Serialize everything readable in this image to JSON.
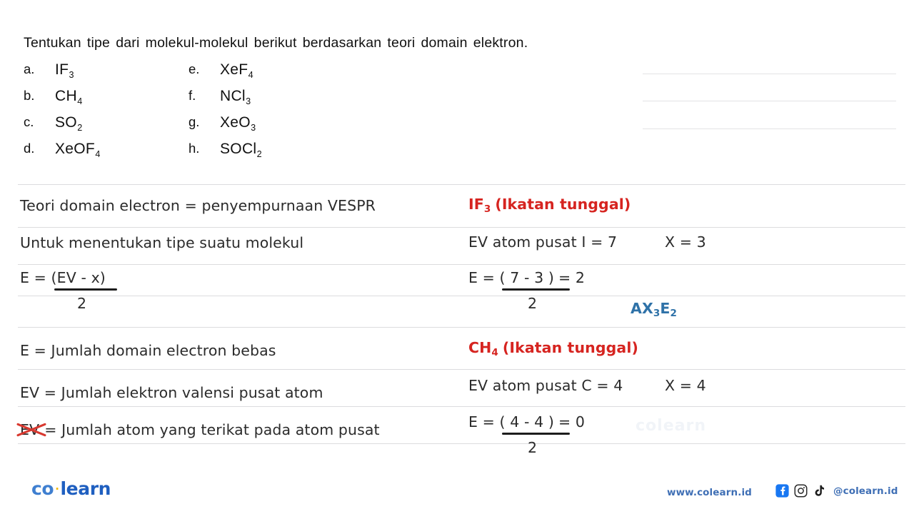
{
  "question": {
    "stem": "Tentukan tipe dari molekul-molekul berikut berdasarkan teori domain elektron.",
    "left_column": [
      {
        "marker": "a.",
        "formula": "IF",
        "sub": "3"
      },
      {
        "marker": "b.",
        "formula": "CH",
        "sub": "4"
      },
      {
        "marker": "c.",
        "formula": "SO",
        "sub": "2"
      },
      {
        "marker": "d.",
        "formula": "XeOF",
        "sub": "4"
      }
    ],
    "right_column": [
      {
        "marker": "e.",
        "formula": "XeF",
        "sub": "4"
      },
      {
        "marker": "f.",
        "formula": "NCl",
        "sub": "3"
      },
      {
        "marker": "g.",
        "formula": "XeO",
        "sub": "3"
      },
      {
        "marker": "h.",
        "formula": "SOCl",
        "sub": "2"
      }
    ]
  },
  "notes_left": {
    "line1": "Teori domain electron = penyempurnaan VESPR",
    "line2": "Untuk menentukan tipe suatu molekul",
    "formula_numerator": "E = (EV - x)",
    "formula_denominator": "2",
    "def_E": "E = Jumlah domain electron bebas",
    "def_EV": "EV = Jumlah elektron valensi pusat atom",
    "def_X_token": "EV",
    "def_X_rest": "= Jumlah atom yang terikat pada atom pusat"
  },
  "notes_right": {
    "block1": {
      "heading": "IF",
      "heading_sub": "3",
      "heading_tail": "(Ikatan tunggal)",
      "ev_label": "EV atom pusat I = 7",
      "x_label": "X = 3",
      "calc_numerator": "E = ( 7  - 3 )",
      "calc_result": "= 2",
      "calc_denominator": "2",
      "answer": "AX",
      "answer_sub1": "3",
      "answer_mid": "E",
      "answer_sub2": "2"
    },
    "block2": {
      "heading": "CH",
      "heading_sub": "4",
      "heading_tail": "(Ikatan tunggal)",
      "ev_label": "EV atom pusat C = 4",
      "x_label": "X = 4",
      "calc_numerator": "E = ( 4  - 4 )",
      "calc_result": "= 0",
      "calc_denominator": "2"
    }
  },
  "watermark": {
    "text": "colearn"
  },
  "footer": {
    "logo_co": "co",
    "logo_dot": "·",
    "logo_learn": "learn",
    "url": "www.colearn.id",
    "handle": "@colearn.id",
    "icons": [
      "facebook-icon",
      "instagram-icon",
      "tiktok-icon"
    ]
  },
  "colors": {
    "red": "#d62420",
    "blue": "#2f72a8",
    "brand_blue": "#1f5fc0",
    "rule": "#e3e3e5"
  }
}
